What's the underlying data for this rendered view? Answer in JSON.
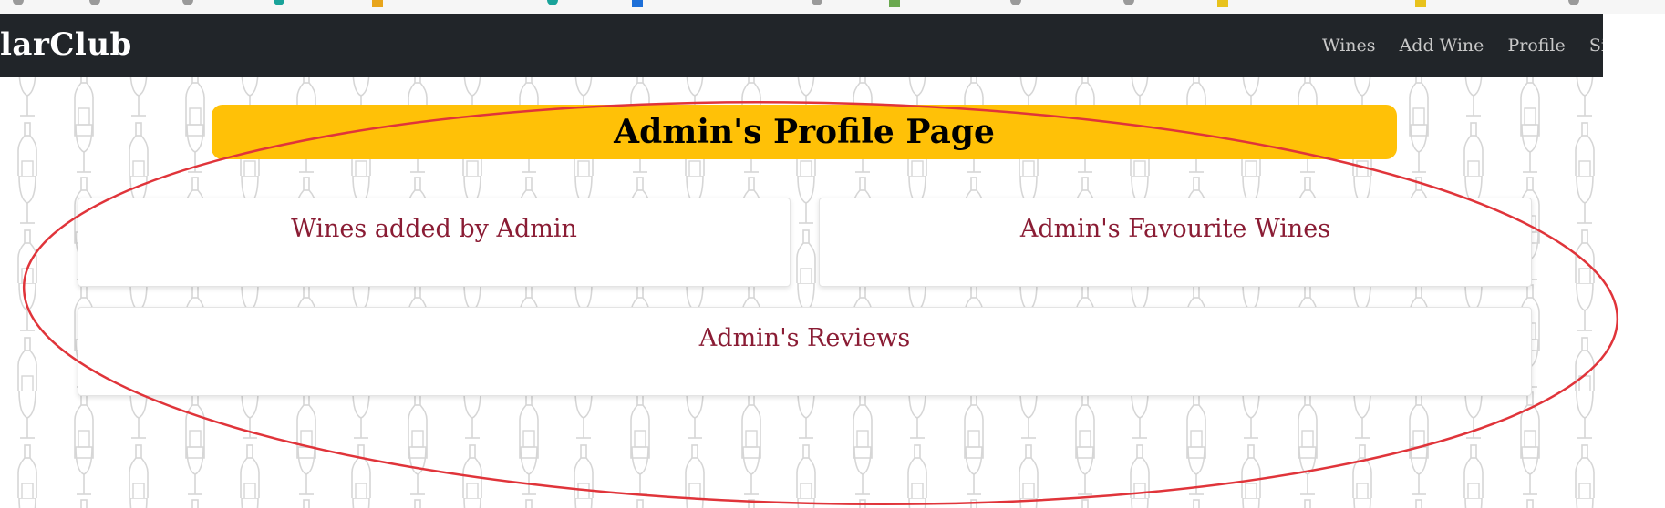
{
  "navbar": {
    "brand": "larClub",
    "links": [
      "Wines",
      "Add Wine",
      "Profile",
      "Sig"
    ]
  },
  "title": "Admin's Profile Page",
  "cards": {
    "wines_added": "Wines added by Admin",
    "favourites": "Admin's Favourite Wines",
    "reviews": "Admin's Reviews"
  },
  "colors": {
    "navbar": "#212529",
    "title_bar": "#ffc107",
    "card_text": "#8a1c34",
    "annotation": "#e0343a"
  },
  "annotation": {
    "shape": "ellipse",
    "icon": "red-ellipse-highlight"
  }
}
